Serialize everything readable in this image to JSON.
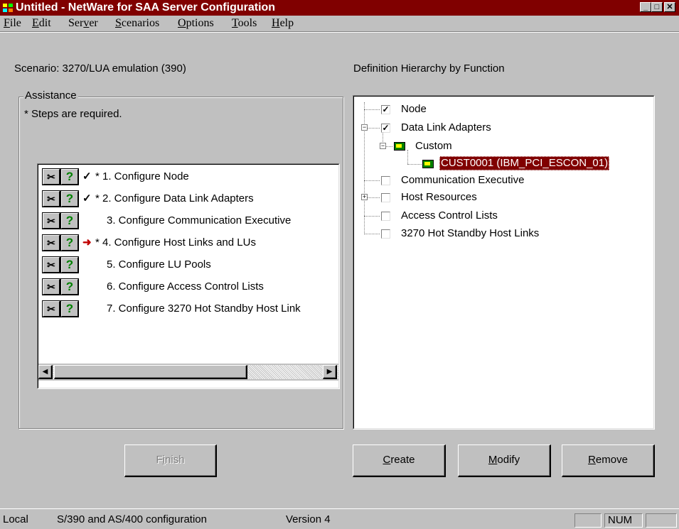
{
  "window": {
    "title": "Untitled - NetWare for SAA Server Configuration",
    "controls": {
      "minimize": "_",
      "maximize": "□",
      "close": "✕"
    }
  },
  "menu": [
    {
      "pre": "",
      "key": "F",
      "post": "ile"
    },
    {
      "pre": "",
      "key": "E",
      "post": "dit"
    },
    {
      "pre": "Ser",
      "key": "v",
      "post": "er"
    },
    {
      "pre": "",
      "key": "S",
      "post": "cenarios"
    },
    {
      "pre": "",
      "key": "O",
      "post": "ptions"
    },
    {
      "pre": "",
      "key": "T",
      "post": "ools"
    },
    {
      "pre": "",
      "key": "H",
      "post": "elp"
    }
  ],
  "scenario_label": "Scenario: 3270/LUA emulation (390)",
  "assistance": {
    "group_label": "Assistance",
    "note": "* Steps are required.",
    "steps": [
      {
        "mark": "✓",
        "text": "* 1.  Configure Node",
        "mark_color": "#000000"
      },
      {
        "mark": "✓",
        "text": "* 2.  Configure Data Link Adapters",
        "mark_color": "#000000"
      },
      {
        "mark": "",
        "text": "3.  Configure  Communication Executive",
        "mark_color": "#000000"
      },
      {
        "mark": "➜",
        "text": "* 4.  Configure Host Links and LUs",
        "mark_color": "#c00000"
      },
      {
        "mark": "",
        "text": "5.  Configure LU Pools",
        "mark_color": "#000000"
      },
      {
        "mark": "",
        "text": "6.  Configure Access Control Lists",
        "mark_color": "#000000"
      },
      {
        "mark": "",
        "text": "7.  Configure 3270 Hot Standby Host Link",
        "mark_color": "#000000"
      }
    ],
    "help_glyph": "?",
    "run_glyph": "✂"
  },
  "hierarchy": {
    "label": "Definition Hierarchy by Function",
    "items": [
      {
        "text": "Node",
        "checked": "✓"
      },
      {
        "text": "Data Link Adapters",
        "checked": "✓"
      },
      {
        "text": "Custom",
        "checked": ""
      },
      {
        "text": "CUST0001 (IBM_PCI_ESCON_01)",
        "checked": ""
      },
      {
        "text": "Communication Executive",
        "checked": ""
      },
      {
        "text": "Host Resources",
        "checked": ""
      },
      {
        "text": "Access Control Lists",
        "checked": ""
      },
      {
        "text": "3270 Hot Standby Host Links",
        "checked": ""
      }
    ],
    "expand_minus": "−",
    "expand_plus": "+"
  },
  "buttons": {
    "finish": {
      "pre": "F",
      "key": "i",
      "post": "nish"
    },
    "create": {
      "pre": "",
      "key": "C",
      "post": "reate"
    },
    "modify": {
      "pre": "",
      "key": "M",
      "post": "odify"
    },
    "remove": {
      "pre": "",
      "key": "R",
      "post": "emove"
    }
  },
  "status": {
    "mode": "Local",
    "config": "S/390 and AS/400 configuration",
    "version": "Version 4",
    "num": "NUM"
  },
  "scroll": {
    "left_arrow": "◀",
    "right_arrow": "▶"
  },
  "colors": {
    "titlebar": "#800000",
    "selection": "#800000",
    "help_green": "#008000",
    "current_arrow": "#c00000"
  }
}
